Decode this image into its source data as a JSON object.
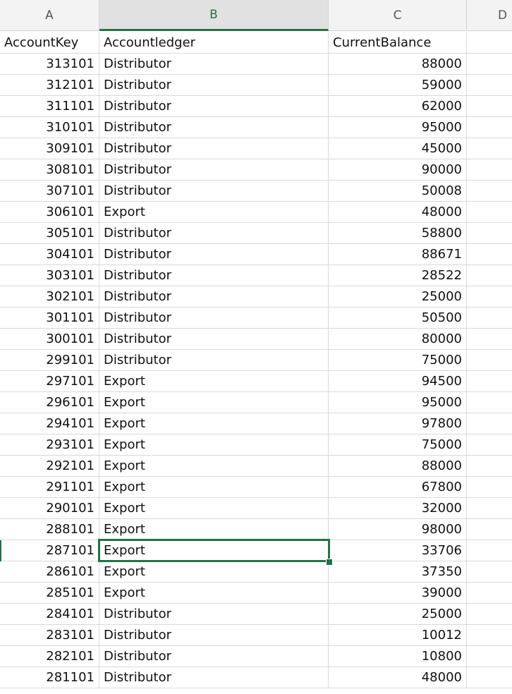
{
  "columns": [
    {
      "letter": "A",
      "active": false
    },
    {
      "letter": "B",
      "active": true
    },
    {
      "letter": "C",
      "active": false
    },
    {
      "letter": "D",
      "active": false
    }
  ],
  "header_row": {
    "key": "AccountKey",
    "ledger": "Accountledger",
    "balance": "CurrentBalance"
  },
  "selected_cell": {
    "column": "B",
    "row_index": 23,
    "value": "Export"
  },
  "rows": [
    {
      "key": "313101",
      "ledger": "Distributor",
      "balance": "88000"
    },
    {
      "key": "312101",
      "ledger": "Distributor",
      "balance": "59000"
    },
    {
      "key": "311101",
      "ledger": "Distributor",
      "balance": "62000"
    },
    {
      "key": "310101",
      "ledger": "Distributor",
      "balance": "95000"
    },
    {
      "key": "309101",
      "ledger": "Distributor",
      "balance": "45000"
    },
    {
      "key": "308101",
      "ledger": "Distributor",
      "balance": "90000"
    },
    {
      "key": "307101",
      "ledger": "Distributor",
      "balance": "50008"
    },
    {
      "key": "306101",
      "ledger": "Export",
      "balance": "48000"
    },
    {
      "key": "305101",
      "ledger": "Distributor",
      "balance": "58800"
    },
    {
      "key": "304101",
      "ledger": "Distributor",
      "balance": "88671"
    },
    {
      "key": "303101",
      "ledger": "Distributor",
      "balance": "28522"
    },
    {
      "key": "302101",
      "ledger": "Distributor",
      "balance": "25000"
    },
    {
      "key": "301101",
      "ledger": "Distributor",
      "balance": "50500"
    },
    {
      "key": "300101",
      "ledger": "Distributor",
      "balance": "80000"
    },
    {
      "key": "299101",
      "ledger": "Distributor",
      "balance": "75000"
    },
    {
      "key": "297101",
      "ledger": "Export",
      "balance": "94500"
    },
    {
      "key": "296101",
      "ledger": "Export",
      "balance": "95000"
    },
    {
      "key": "294101",
      "ledger": "Export",
      "balance": "97800"
    },
    {
      "key": "293101",
      "ledger": "Export",
      "balance": "75000"
    },
    {
      "key": "292101",
      "ledger": "Export",
      "balance": "88000"
    },
    {
      "key": "291101",
      "ledger": "Export",
      "balance": "67800"
    },
    {
      "key": "290101",
      "ledger": "Export",
      "balance": "32000"
    },
    {
      "key": "288101",
      "ledger": "Export",
      "balance": "98000"
    },
    {
      "key": "287101",
      "ledger": "Export",
      "balance": "33706"
    },
    {
      "key": "286101",
      "ledger": "Export",
      "balance": "37350"
    },
    {
      "key": "285101",
      "ledger": "Export",
      "balance": "39000"
    },
    {
      "key": "284101",
      "ledger": "Distributor",
      "balance": "25000"
    },
    {
      "key": "283101",
      "ledger": "Distributor",
      "balance": "10012"
    },
    {
      "key": "282101",
      "ledger": "Distributor",
      "balance": "10800"
    },
    {
      "key": "281101",
      "ledger": "Distributor",
      "balance": "48000"
    }
  ],
  "colors": {
    "accent": "#217346",
    "header_bg": "#f3f3f3",
    "gridline": "#d9d9d9"
  }
}
